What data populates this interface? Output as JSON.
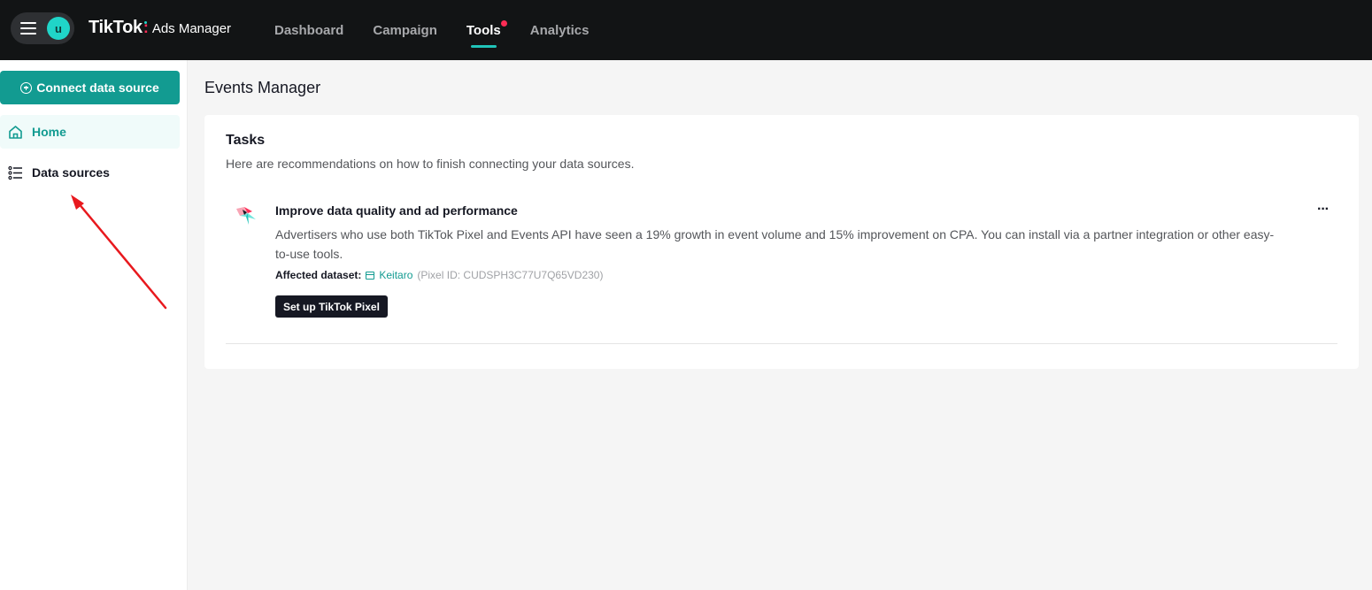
{
  "header": {
    "avatar_initial": "u",
    "brand_logo": "TikTok",
    "brand_product": "Ads Manager",
    "nav": [
      {
        "label": "Dashboard",
        "active": false
      },
      {
        "label": "Campaign",
        "active": false
      },
      {
        "label": "Tools",
        "active": true,
        "notification": true
      },
      {
        "label": "Analytics",
        "active": false
      }
    ]
  },
  "sidebar": {
    "connect_label": "Connect data source",
    "items": [
      {
        "label": "Home",
        "icon": "home-icon",
        "active": true
      },
      {
        "label": "Data sources",
        "icon": "list-icon",
        "active": false
      }
    ]
  },
  "main": {
    "page_title": "Events Manager",
    "tasks": {
      "title": "Tasks",
      "subtitle": "Here are recommendations on how to finish connecting your data sources.",
      "task": {
        "title": "Improve data quality and ad performance",
        "description": "Advertisers who use both TikTok Pixel and Events API have seen a 19% growth in event volume and 15% improvement on CPA. You can install via a partner integration or other easy-to-use tools.",
        "affected_label": "Affected dataset:",
        "dataset_name": "Keitaro",
        "dataset_id": "(Pixel ID: CUDSPH3C77U7Q65VD230)",
        "button_label": "Set up TikTok Pixel",
        "more_label": "···"
      }
    }
  },
  "colors": {
    "accent": "#129b91",
    "topbar": "#121415",
    "annotation_arrow": "#e8191e"
  }
}
